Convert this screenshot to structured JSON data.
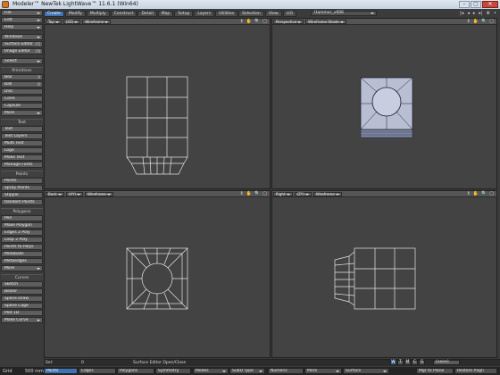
{
  "window": {
    "title": "Modeler™ NewTek LightWave™ 11.6.1 (Win64)"
  },
  "window_buttons": [
    "–",
    "▢",
    "✕"
  ],
  "left_menu": {
    "top": [
      {
        "label": "File",
        "dropdown": true
      },
      {
        "label": "Edit",
        "dropdown": true
      },
      {
        "label": "Help",
        "dropdown": true
      },
      {
        "label": "Windows",
        "dropdown": true
      },
      {
        "label": "Surface Editor",
        "shortcut": "F5"
      },
      {
        "label": "Image Editor",
        "shortcut": "F6"
      },
      {
        "label": "Select",
        "dropdown": true
      }
    ],
    "sections": [
      {
        "header": "Primitives",
        "items": [
          "Box",
          "Ball",
          "Disc",
          "Cone",
          "Capsule",
          "More"
        ],
        "shortcuts": {
          "Box": "X",
          "Ball": "O"
        }
      },
      {
        "header": "Text",
        "items": [
          "Text",
          "Text Layers",
          "Multi Text",
          "Logo",
          "Make Text",
          "Manage Fonts"
        ]
      },
      {
        "header": "Points",
        "items": [
          "Points",
          "Spray Points",
          "Stipple",
          "Random Points"
        ]
      },
      {
        "header": "Polygons",
        "items": [
          "Pen",
          "Make Polygon",
          "Edges 2 Poly",
          "Loop 2 Poly",
          "Points to Polys",
          "Metaballs",
          "Metaedges",
          "More"
        ]
      },
      {
        "header": "Curves",
        "items": [
          "Sketch",
          "Bezier",
          "Spline Draw",
          "Spline Cage",
          "Plot 1D",
          "Make Curve"
        ]
      }
    ]
  },
  "tabs": [
    "Create",
    "Modify",
    "Multiply",
    "Construct",
    "Detail",
    "Map",
    "Setup",
    "Layers",
    "Utilities",
    "Selection",
    "View",
    "LIO"
  ],
  "active_tab": "Create",
  "object_selector": "Hammer_v006",
  "top_icons": [
    "|◂",
    "◂",
    "▸",
    "▸|",
    "⚙",
    "•"
  ],
  "viewports": [
    {
      "view": "Top",
      "axis": "(XZ)",
      "mode": "Wireframe"
    },
    {
      "view": "Perspective",
      "axis": "",
      "mode": "Wireframe Shade"
    },
    {
      "view": "Back",
      "axis": "(XY)",
      "mode": "Wireframe"
    },
    {
      "view": "Right",
      "axis": "(ZY)",
      "mode": "Wireframe"
    }
  ],
  "viewport_icons": [
    "⇕",
    "✋",
    "🔍",
    "▢"
  ],
  "status": {
    "left": "Sel:",
    "count": "0",
    "message": "Surface Editor Open/Close"
  },
  "small_buttons": [
    "W",
    "T",
    "M",
    "C",
    "S"
  ],
  "small_buttons_active": "W",
  "mode_button": "(none)",
  "bottom_bar": {
    "grid_label": "Grid",
    "grid_value": "500 mm",
    "points": "Points",
    "edges": "Edges",
    "polygons": "Polygons",
    "symmetry": "Symmetry",
    "modes": "Modes",
    "subd_type": "SubD Type",
    "numeric": "Numeric",
    "more": "More",
    "surface": "Surface",
    "right1": "Mgr to Plane",
    "right2": "Restore Align"
  },
  "colors": {
    "accent": "#3f72b2",
    "background": "#3b3b3b",
    "viewport": "#434343",
    "mesh": "#e6e6e6",
    "persp_face": "#b9bfd3"
  }
}
